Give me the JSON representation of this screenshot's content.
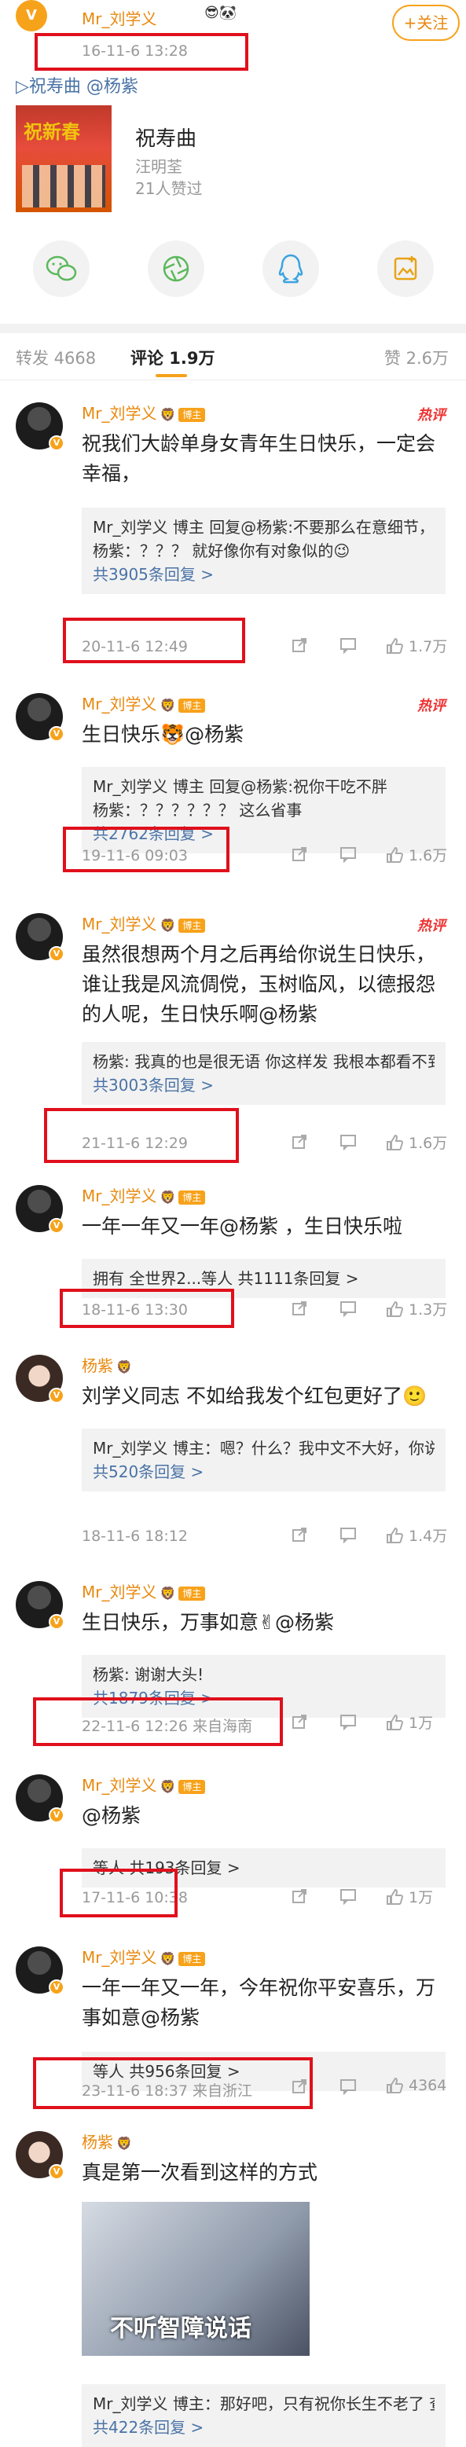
{
  "header": {
    "username": "Mr_刘学义",
    "timestamp": "16-11-6 13:28",
    "follow": "+关注",
    "post_text": "▷祝寿曲 @杨紫"
  },
  "music": {
    "title": "祝寿曲",
    "artist": "汪明荃",
    "likes": "21人赞过",
    "cover_text": "祝新春"
  },
  "share": {
    "icons": [
      "wechat-icon",
      "moments-icon",
      "qq-icon",
      "save-image-icon"
    ]
  },
  "tabs": {
    "repost": "转发 4668",
    "comments": "评论 1.9万",
    "likes": "赞 2.6万"
  },
  "labels": {
    "badge": "博主",
    "hot": "热评"
  },
  "comments": [
    {
      "name": "Mr_刘学义",
      "text": "祝我们大龄单身女青年生日快乐，一定会幸福，",
      "replies": [
        "Mr_刘学义 博主 回复@杨紫:不要那么在意细节，明年再说吧，",
        "杨紫：？？？ 就好像你有对象似的😉"
      ],
      "more": "共3905条回复 >",
      "time": "20-11-6 12:49",
      "likes": "1.7万"
    },
    {
      "name": "Mr_刘学义",
      "text": "生日快乐🐯@杨紫",
      "replies": [
        "Mr_刘学义 博主 回复@杨紫:祝你干吃不胖",
        "杨紫：？？？？？？ 这么省事"
      ],
      "more": "共2762条回复 >",
      "time": "19-11-6 09:03",
      "likes": "1.6万"
    },
    {
      "name": "Mr_刘学义",
      "text": "虽然很想两个月之后再给你说生日快乐，谁让我是风流倜傥，玉树临风，以德报怨的人呢，生日快乐啊@杨紫",
      "replies": [
        "杨紫: 我真的也是很无语 你这样发 我根本都看不到 不如来个红包实在"
      ],
      "more": "共3003条回复 >",
      "time": "21-11-6 12:29",
      "likes": "1.6万"
    },
    {
      "name": "Mr_刘学义",
      "text": "一年一年又一年@杨紫 ，生日快乐啦",
      "replies": [
        "拥有 全世界2...等人 共1111条回复 >"
      ],
      "more": "",
      "time": "18-11-6 13:30",
      "likes": "1.3万"
    },
    {
      "name": "杨紫",
      "text": "刘学义同志 不如给我发个红包更好了🙂",
      "replies": [
        "Mr_刘学义 博主：嗯？什么？我中文不大好，你说什么我好像听不大懂，不好意思啊😉"
      ],
      "more": "共520条回复 >",
      "time": "18-11-6 18:12",
      "likes": "1.4万"
    },
    {
      "name": "Mr_刘学义",
      "text": "生日快乐，万事如意✌@杨紫",
      "replies": [
        "杨紫: 谢谢大头!"
      ],
      "more": "共1879条回复 >",
      "time": "22-11-6 12:26 来自海南",
      "likes": "1万"
    },
    {
      "name": "Mr_刘学义",
      "text": "@杨紫",
      "replies": [
        "等人 共193条回复 >"
      ],
      "more": "",
      "time": "17-11-6 10:38",
      "likes": "1万"
    },
    {
      "name": "Mr_刘学义",
      "text": "一年一年又一年，今年祝你平安喜乐，万事如意@杨紫",
      "replies": [
        "等人 共956条回复 >"
      ],
      "more": "",
      "time": "23-11-6 18:37 来自浙江",
      "likes": "4364"
    },
    {
      "name": "杨紫",
      "text": "真是第一次看到这样的方式",
      "image_caption": "不听智障说话",
      "replies": [
        "Mr_刘学义 博主：那好吧，只有祝你长生不老了 查看图片"
      ],
      "more": "共422条回复 >",
      "time": "",
      "likes": ""
    }
  ],
  "colors": {
    "name": "#e8890f",
    "link": "#4a73a6",
    "highlight_box": "#e0101c",
    "hot": "#e33333",
    "reply_bg": "#f2f2f2"
  }
}
